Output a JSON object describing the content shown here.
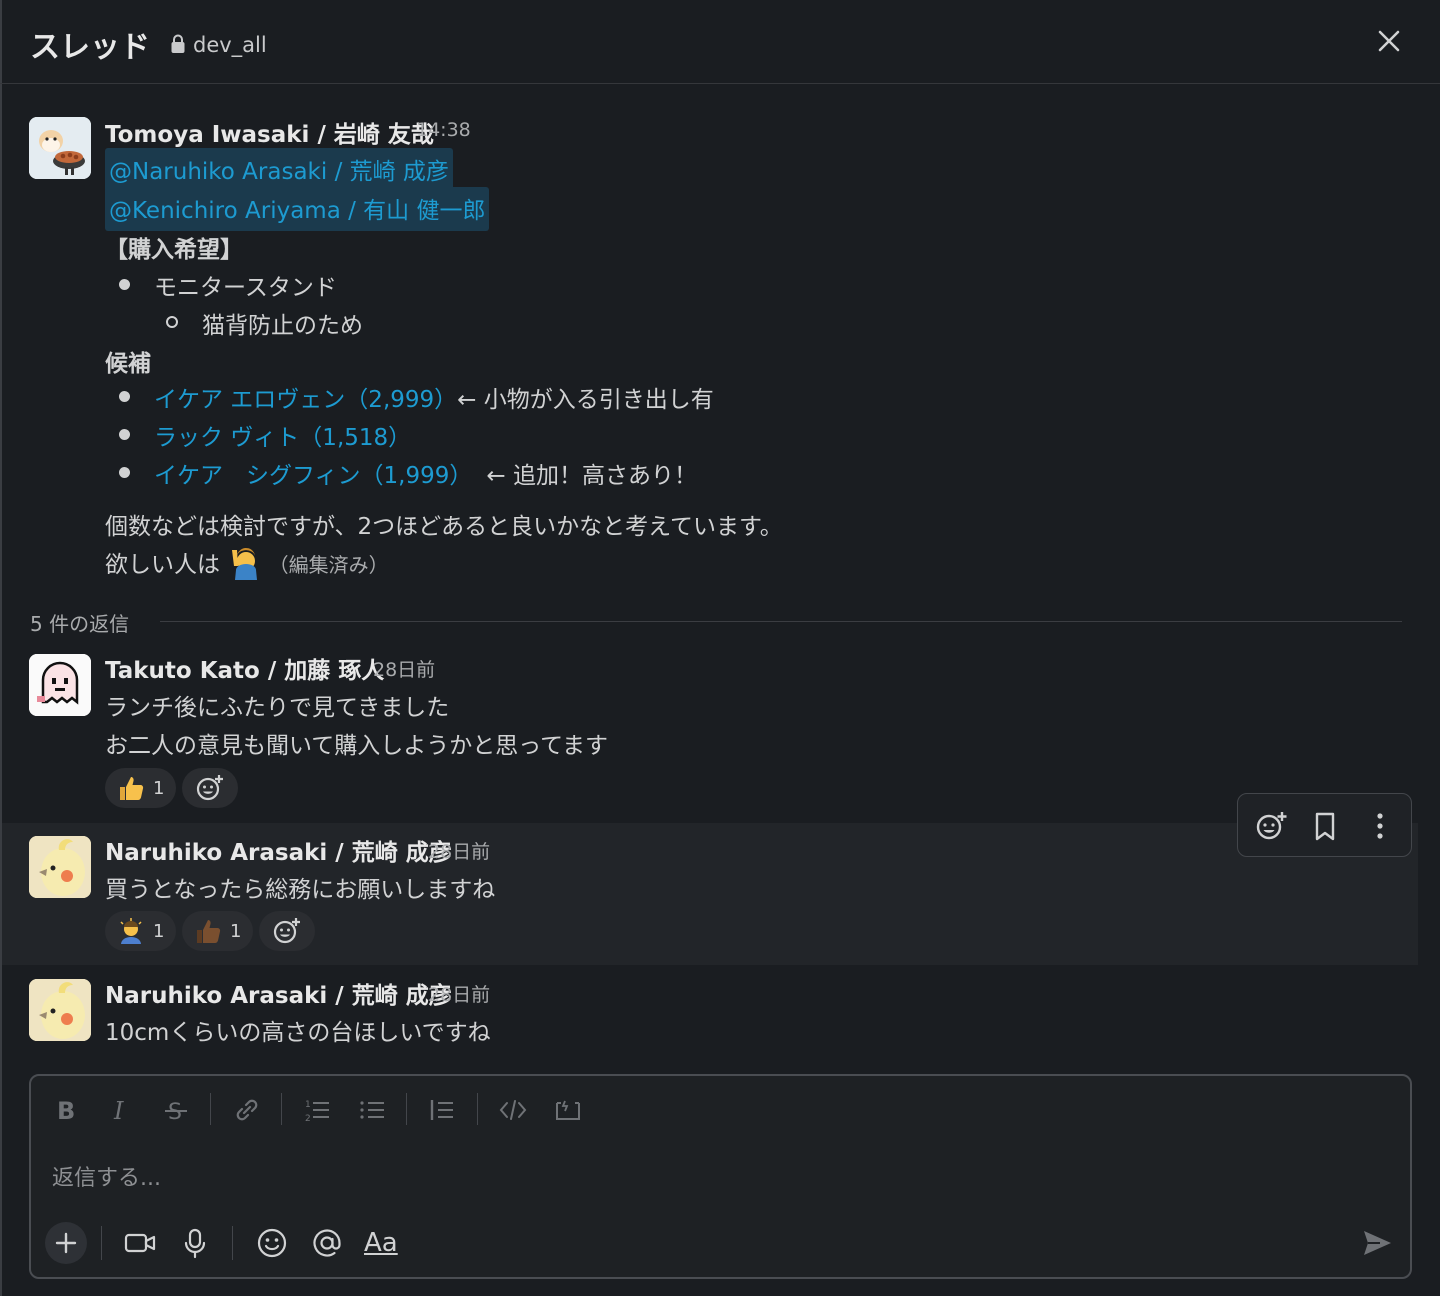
{
  "header": {
    "title": "スレッド",
    "channel": "dev_all"
  },
  "parent": {
    "author": "Tomoya Iwasaki / 岩崎 友哉",
    "time": "14:38",
    "mentions": [
      "@Naruhiko Arasaki / 荒崎 成彦",
      "@Kenichiro Ariyama / 有山 健一郎"
    ],
    "heading1": "【購入希望】",
    "item1": "モニタースタンド",
    "subitem1": "猫背防止のため",
    "heading2": "候補",
    "candidates": [
      {
        "link": "イケア エロヴェン（2,999）",
        "note": "← 小物が入る引き出し有"
      },
      {
        "link": "ラック ヴィト（1,518）",
        "note": ""
      },
      {
        "link": "イケア　シグフィン（1,999）",
        "note": "← 追加！高さあり！"
      }
    ],
    "line1": "個数などは検討ですが、2つほどあると良いかなと考えています。",
    "line2": "欲しい人は",
    "edited": "（編集済み）"
  },
  "replies_label": "5 件の返信",
  "replies": [
    {
      "author": "Takuto Kato / 加藤 琢人",
      "time": "28日前",
      "lines": [
        "ランチ後にふたりで見てきました",
        "お二人の意見も聞いて購入しようかと思ってます"
      ],
      "reactions": [
        {
          "emoji": "thumbs-up",
          "count": "1"
        }
      ]
    },
    {
      "author": "Naruhiko Arasaki / 荒崎 成彦",
      "time": "28日前",
      "lines": [
        "買うとなったら総務にお願いしますね"
      ],
      "reactions": [
        {
          "emoji": "bowing-person",
          "count": "1"
        },
        {
          "emoji": "thumbs-up-dark",
          "count": "1"
        }
      ]
    },
    {
      "author": "Naruhiko Arasaki / 荒崎 成彦",
      "time": "28日前",
      "lines": [
        "10cmくらいの高さの台ほしいですね"
      ],
      "reactions": []
    }
  ],
  "composer": {
    "placeholder": "返信する...",
    "text_style_label": "Aa"
  },
  "colors": {
    "background": "#1a1d21",
    "link": "#1d9bd1",
    "mention_bg": "#1b3a4d"
  }
}
